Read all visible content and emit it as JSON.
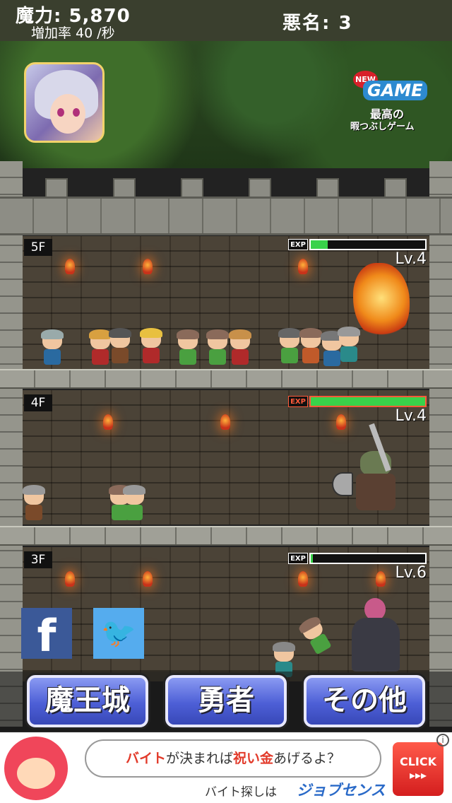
{
  "status": {
    "mana_text": "魔力: 5,870",
    "mana_rate_text": "増加率 40 /秒",
    "infamy_text": "悪名: 3"
  },
  "promo": {
    "new_label": "NEW",
    "game_label": "GAME",
    "line1": "最高の",
    "line2": "暇つぶしゲーム"
  },
  "floors": [
    {
      "label": "5F",
      "level": "Lv.4",
      "exp_label": "EXP",
      "exp_progress": 0.15
    },
    {
      "label": "4F",
      "level": "Lv.4",
      "exp_label": "EXP",
      "exp_progress": 1.0
    },
    {
      "label": "3F",
      "level": "Lv.6",
      "exp_label": "EXP",
      "exp_progress": 0.02
    }
  ],
  "social": {
    "facebook_glyph": "f",
    "twitter_glyph": "🐦"
  },
  "menu": {
    "castle": "魔王城",
    "hero": "勇者",
    "other": "その他"
  },
  "ad": {
    "bubble_part1": "バイト",
    "bubble_part2": "が決まれば",
    "bubble_part3": "祝い金",
    "bubble_part4": "あげるよ？",
    "sub": "バイト探しは",
    "brand": "ジョブセンス",
    "click": "CLICK",
    "click_arrows": "▸▸▸",
    "info": "i"
  },
  "colors": {
    "exp_fill": "#39d24a",
    "button": "#4d5fd6",
    "ad_red": "#e23a2a"
  }
}
